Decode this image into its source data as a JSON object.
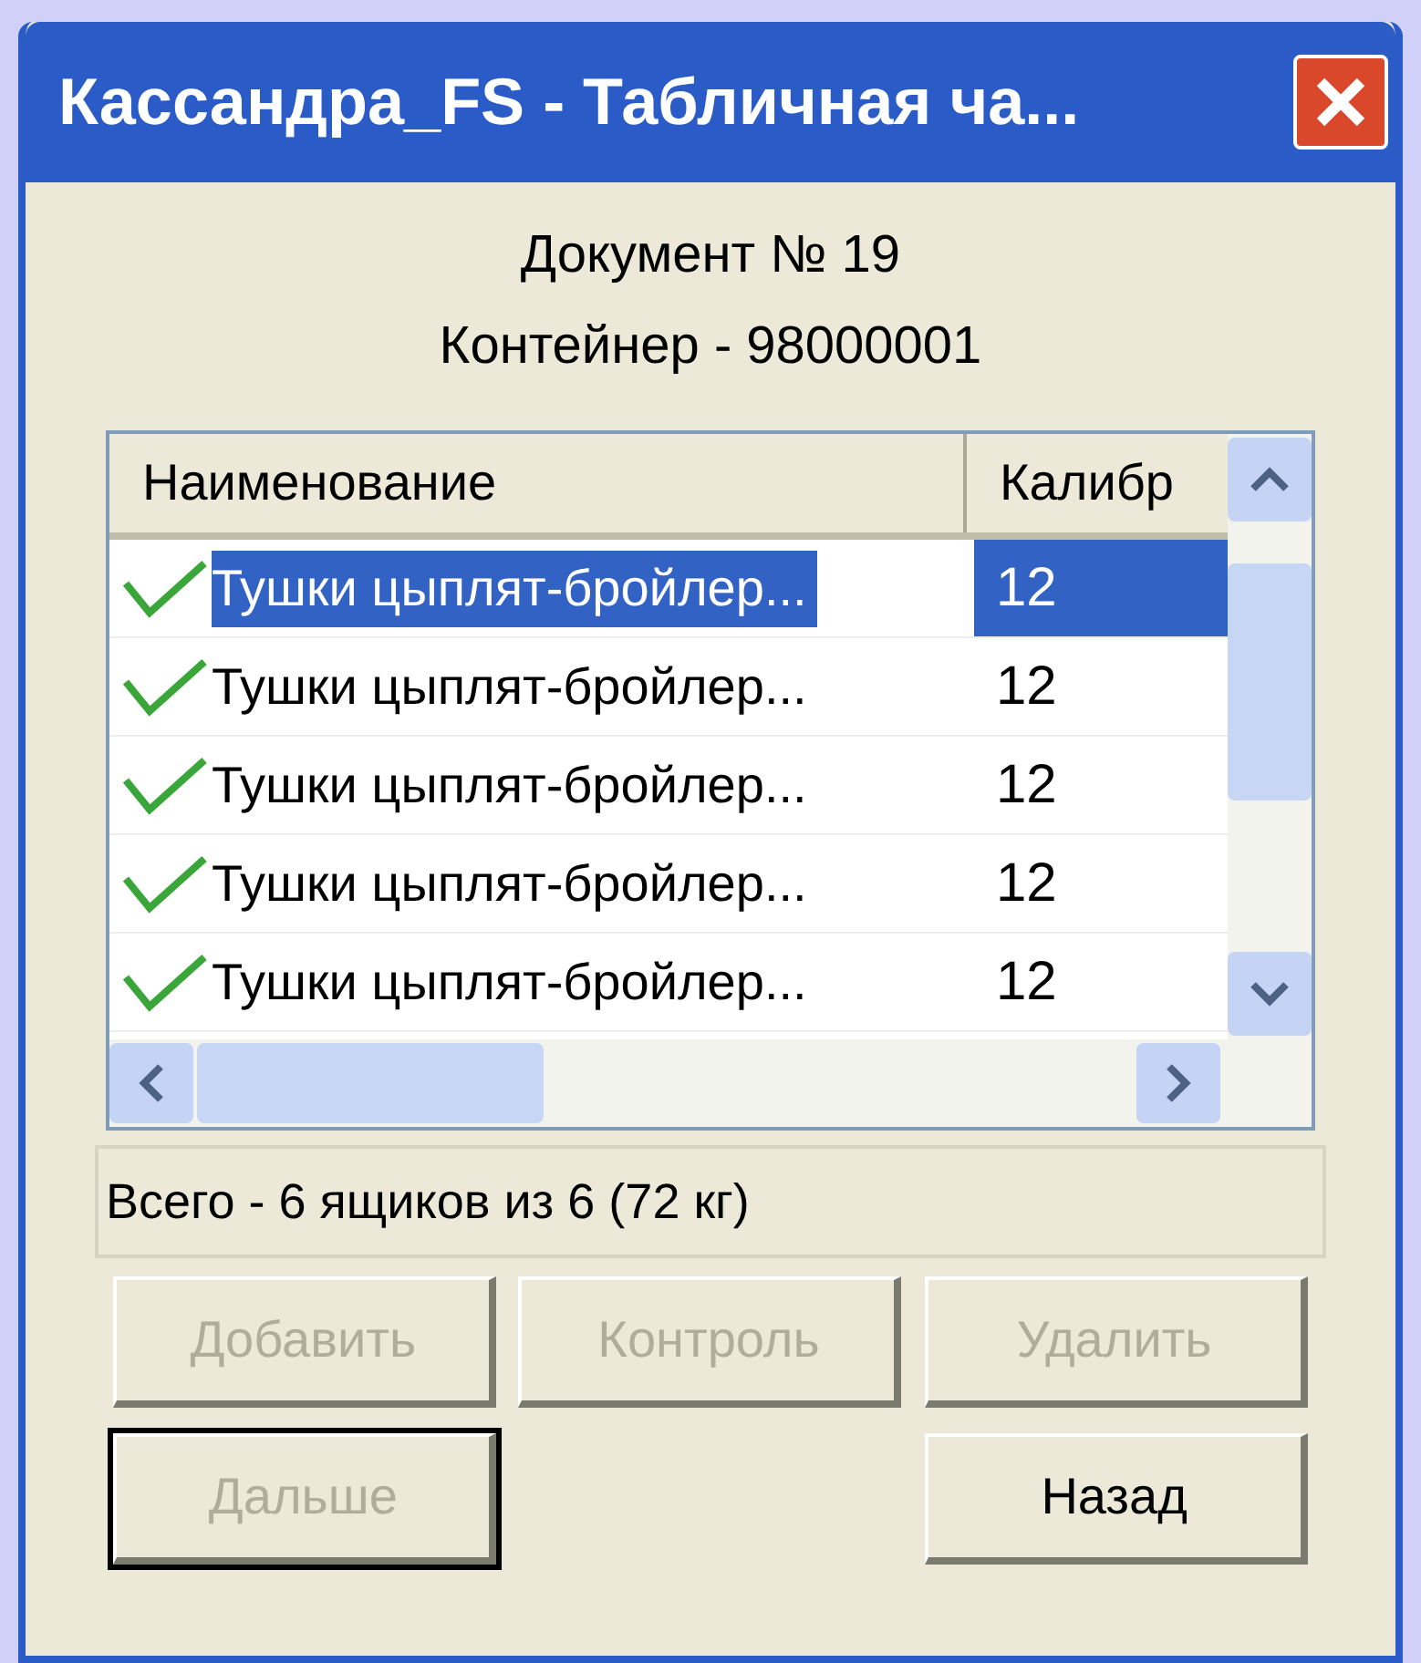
{
  "window": {
    "title": "Кассандра_FS - Табличная ча..."
  },
  "header": [
    "Документ № 19",
    "Контейнер - 98000001"
  ],
  "table": {
    "columns": [
      "Наименование",
      "Калибр"
    ],
    "rows": [
      {
        "name": "Тушки цыплят-бройлер...",
        "caliber": "12",
        "checked": true,
        "selected": true
      },
      {
        "name": "Тушки цыплят-бройлер...",
        "caliber": "12",
        "checked": true,
        "selected": false
      },
      {
        "name": "Тушки цыплят-бройлер...",
        "caliber": "12",
        "checked": true,
        "selected": false
      },
      {
        "name": "Тушки цыплят-бройлер...",
        "caliber": "12",
        "checked": true,
        "selected": false
      },
      {
        "name": "Тушки цыплят-бройлер...",
        "caliber": "12",
        "checked": true,
        "selected": false
      }
    ]
  },
  "status": "Всего - 6 ящиков из 6 (72 кг)",
  "buttons": {
    "top_row": [
      {
        "label": "Добавить",
        "disabled": true,
        "default": false
      },
      {
        "label": "Контроль",
        "disabled": true,
        "default": false
      },
      {
        "label": "Удалить",
        "disabled": true,
        "default": false
      }
    ],
    "bottom_left": {
      "label": "Дальше",
      "disabled": true,
      "default": true
    },
    "bottom_right": {
      "label": "Назад",
      "disabled": false,
      "default": false
    }
  }
}
